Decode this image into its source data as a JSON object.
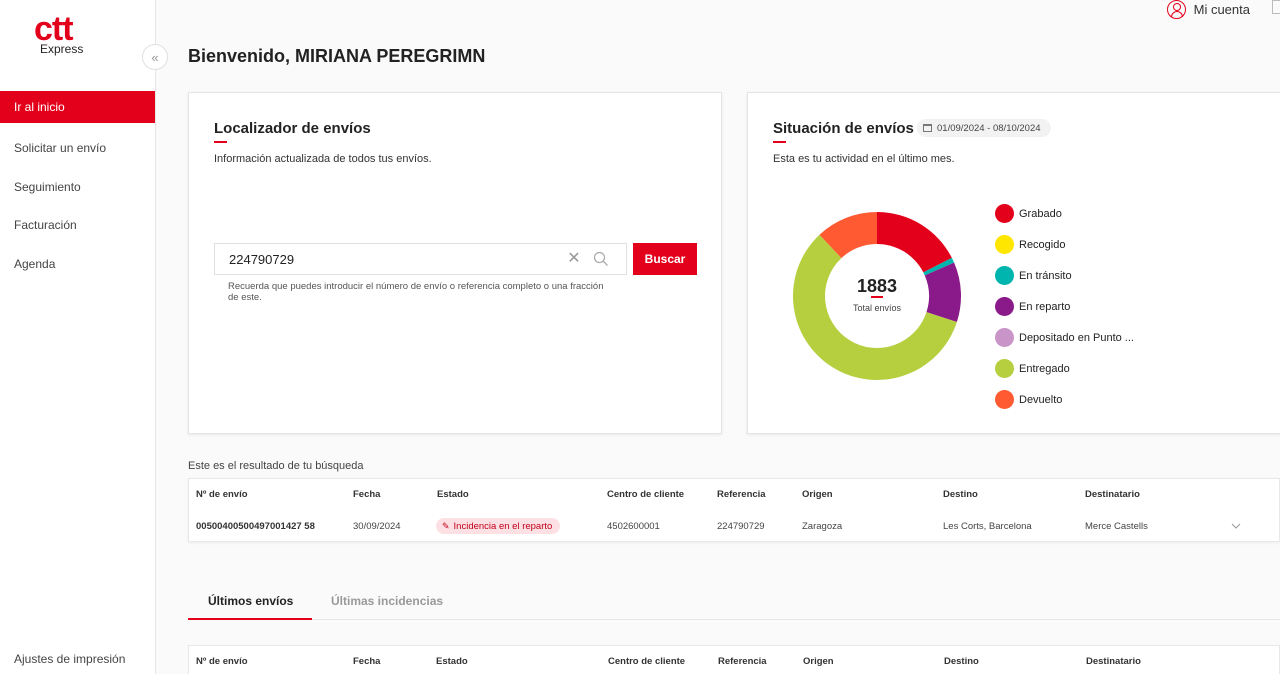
{
  "brand": {
    "logo_main": "ctt",
    "logo_sub": "Express",
    "accent": "#e3001b"
  },
  "sidebar": {
    "items": [
      {
        "label": "Ir al inicio",
        "active": true
      },
      {
        "label": "Solicitar un envío"
      },
      {
        "label": "Seguimiento"
      },
      {
        "label": "Facturación"
      },
      {
        "label": "Agenda"
      }
    ],
    "bottom_label": "Ajustes de impresión",
    "collapse_glyph": "«"
  },
  "header": {
    "account_label": "Mi cuenta"
  },
  "welcome": "Bienvenido, MIRIANA PEREGRIMN",
  "locator": {
    "title": "Localizador de envíos",
    "subtitle": "Información actualizada de todos tus envíos.",
    "search_value": "224790729",
    "button_label": "Buscar",
    "hint": "Recuerda que puedes introducir el número de envío o referencia completo o una fracción de este."
  },
  "situation": {
    "title": "Situación de envíos",
    "date_range": "01/09/2024 - 08/10/2024",
    "subtitle": "Esta es tu actividad en el último mes.",
    "total_value": "1883",
    "total_label": "Total envíos"
  },
  "chart_data": {
    "type": "pie",
    "categories": [
      "Grabado",
      "Recogido",
      "En tránsito",
      "En reparto",
      "Depositado en Punto ...",
      "Entregado",
      "Devuelto"
    ],
    "values": [
      17.5,
      0,
      1,
      11.5,
      0,
      58,
      12
    ],
    "colors": [
      "#e3001b",
      "#ffe600",
      "#00b5ad",
      "#8a1a8a",
      "#c994c7",
      "#b5cf3f",
      "#ff5a32"
    ],
    "total": 1883
  },
  "result": {
    "title": "Este es el resultado de tu búsqueda",
    "headers": [
      "Nº de envío",
      "Fecha",
      "Estado",
      "Centro de cliente",
      "Referencia",
      "Origen",
      "Destino",
      "Destinatario"
    ],
    "row": {
      "envio": "00500400500497001427 58",
      "fecha": "30/09/2024",
      "estado": "Incidencia en el reparto",
      "centro": "4502600001",
      "referencia": "224790729",
      "origen": "Zaragoza",
      "destino": "Les Corts, Barcelona",
      "destinatario": "Merce Castells"
    }
  },
  "tabs": [
    {
      "label": "Últimos envíos",
      "active": true
    },
    {
      "label": "Últimas incidencias"
    }
  ],
  "table2": {
    "headers": [
      "Nº de envío",
      "Fecha",
      "Estado",
      "Centro de cliente",
      "Referencia",
      "Origen",
      "Destino",
      "Destinatario"
    ]
  }
}
